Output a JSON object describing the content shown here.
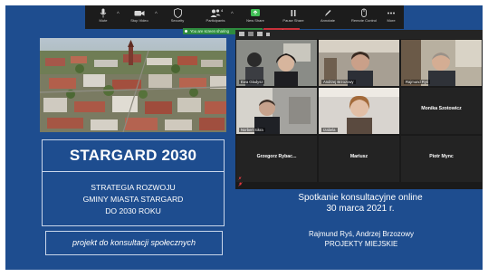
{
  "toolbar": {
    "items": [
      {
        "label": "Mute",
        "icon": "microphone-icon"
      },
      {
        "label": "Stop Video",
        "icon": "video-camera-icon"
      },
      {
        "label": "Security",
        "icon": "shield-icon"
      },
      {
        "label": "Participants",
        "icon": "participants-icon",
        "count": "4"
      },
      {
        "label": "New Share",
        "icon": "share-screen-icon"
      },
      {
        "label": "Pause Share",
        "icon": "pause-icon"
      },
      {
        "label": "Annotate",
        "icon": "pen-icon"
      },
      {
        "label": "Remote Control",
        "icon": "mouse-icon"
      },
      {
        "label": "More",
        "icon": "more-icon"
      }
    ]
  },
  "share_indicator": {
    "sharing_text": "You are screen sharing",
    "stop_label": "Stop Share"
  },
  "slide": {
    "main_title": "STARGARD 2030",
    "subtitle_lines": [
      "STRATEGIA ROZWOJU",
      "GMINY MIASTA STARGARD",
      "DO 2030 ROKU"
    ],
    "consultation_note": "projekt do konsultacji społecznych",
    "meeting_title": "Spotkanie konsultacyjne online",
    "meeting_date": "30 marca 2021 r.",
    "authors": "Rajmund Ryś, Andrzej Brzozowy",
    "company": "PROJEKTY MIEJSKIE"
  },
  "participants": [
    {
      "name": "Ewa Gładysz",
      "video": true
    },
    {
      "name": "Andrzej Brzozowy",
      "video": true
    },
    {
      "name": "Rajmund Ryś",
      "video": true
    },
    {
      "name": "Norbert Sikra",
      "video": true
    },
    {
      "name": "Izabela",
      "video": true
    },
    {
      "name": "Monika Szotowicz",
      "video": false
    },
    {
      "name": "Grzegorz Rybac...",
      "video": false
    },
    {
      "name": "Mariusz",
      "video": false
    },
    {
      "name": "Piotr Mync",
      "video": false
    }
  ],
  "colors": {
    "slide_background": "#1e4d8f",
    "toolbar_background": "#1c1c1c",
    "share_green": "#2e8b3e",
    "stop_red": "#c8313a",
    "speaking_highlight": "#8bd14a"
  }
}
